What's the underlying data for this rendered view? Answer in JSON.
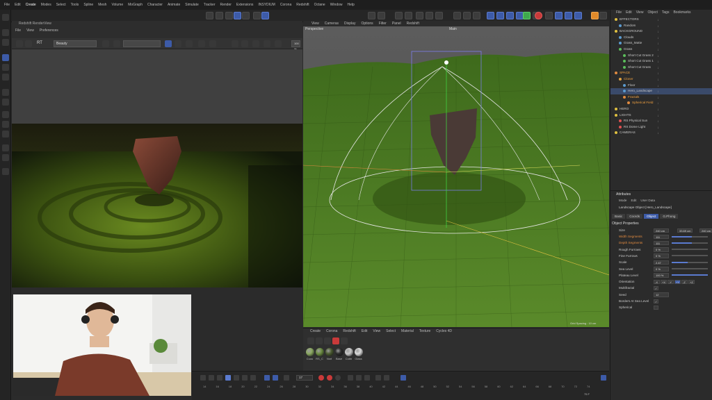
{
  "menubar": [
    "File",
    "Edit",
    "Create",
    "Modes",
    "Select",
    "Tools",
    "Spline",
    "Mesh",
    "Volume",
    "MoGraph",
    "Character",
    "Animate",
    "Simulate",
    "Tracker",
    "Render",
    "Extensions",
    "INSYDIUM",
    "Corona",
    "Redshift",
    "Octane",
    "Window",
    "Help"
  ],
  "menubar_active": "Create",
  "renderview": {
    "title": "Redshift RenderView",
    "menu": [
      "File",
      "View",
      "Preferences"
    ],
    "mode": "Beauty",
    "zoom": "100 %"
  },
  "viewport": {
    "menu": [
      "View",
      "Cameras",
      "Display",
      "Options",
      "Filter",
      "Panel",
      "Redshift"
    ],
    "label_left": "Perspective",
    "label_center": "Main",
    "grid_spacing": "Grid Spacing : 10 cm"
  },
  "material_panel": {
    "menu": [
      "Create",
      "Corona",
      "Redshift",
      "Edit",
      "View",
      "Select",
      "Material",
      "Texture",
      "Cycles 4D"
    ],
    "materials": [
      {
        "label": "Cuou",
        "color": "#8aa860"
      },
      {
        "label": "RS_C",
        "color": "#6a8a40"
      },
      {
        "label": "Nsrt",
        "color": "#4a5a30"
      },
      {
        "label": "Base",
        "color": "#2a2a2a"
      },
      {
        "label": "Cobb",
        "color": "#c8c8c8"
      },
      {
        "label": "Glass",
        "color": "#dcdcdc"
      }
    ]
  },
  "timeline": {
    "current_frame": "17",
    "ticks": [
      "14",
      "16",
      "18",
      "20",
      "22",
      "24",
      "26",
      "28",
      "30",
      "32",
      "34",
      "36",
      "38",
      "40",
      "42",
      "44",
      "46",
      "48",
      "50",
      "52",
      "54",
      "56",
      "58",
      "60",
      "62",
      "64",
      "66",
      "68",
      "70",
      "72",
      "74"
    ],
    "end_frame": "75 F"
  },
  "objects": {
    "menu": [
      "File",
      "Edit",
      "View",
      "Object",
      "Tags",
      "Bookmarks"
    ],
    "items": [
      {
        "name": "EFFECTORS",
        "indent": 0,
        "color": "#e0c040",
        "state": ""
      },
      {
        "name": "Random",
        "indent": 1,
        "color": "#5b9bd0",
        "state": ""
      },
      {
        "name": "BACKGROUND",
        "indent": 0,
        "color": "#e0c040",
        "state": ""
      },
      {
        "name": "Clouds",
        "indent": 1,
        "color": "#5b9bd0",
        "state": ""
      },
      {
        "name": "Grass_Matte",
        "indent": 1,
        "color": "#5b9bd0",
        "state": ""
      },
      {
        "name": "Grass",
        "indent": 1,
        "color": "#5bbd5b",
        "state": ""
      },
      {
        "name": "Short Cut Grass 2",
        "indent": 2,
        "color": "#5bbd5b",
        "state": ""
      },
      {
        "name": "Short Cut Grass 1",
        "indent": 2,
        "color": "#5bbd5b",
        "state": ""
      },
      {
        "name": "Short Cut Grass",
        "indent": 2,
        "color": "#5bbd5b",
        "state": ""
      },
      {
        "name": "SPACE",
        "indent": 0,
        "color": "#e08a40",
        "state": "hl"
      },
      {
        "name": "Cloner",
        "indent": 1,
        "color": "#e0a040",
        "state": "hl"
      },
      {
        "name": "Floor",
        "indent": 2,
        "color": "#5b9bd0",
        "state": ""
      },
      {
        "name": "Hero_Landscape",
        "indent": 2,
        "color": "#5b9bd0",
        "state": "sel"
      },
      {
        "name": "Fractals",
        "indent": 2,
        "color": "#e08a40",
        "state": "hl"
      },
      {
        "name": "Spherical Field",
        "indent": 3,
        "color": "#e08a40",
        "state": "hl"
      },
      {
        "name": "HERO",
        "indent": 0,
        "color": "#e0c040",
        "state": ""
      },
      {
        "name": "LIGHTS",
        "indent": 0,
        "color": "#e0c040",
        "state": ""
      },
      {
        "name": "RS Physical Sun",
        "indent": 1,
        "color": "#e05050",
        "state": ""
      },
      {
        "name": "RS Dome Light",
        "indent": 1,
        "color": "#e05050",
        "state": ""
      },
      {
        "name": "CAMERAS",
        "indent": 0,
        "color": "#e0c040",
        "state": ""
      }
    ]
  },
  "attributes": {
    "title": "Attributes",
    "menu": [
      "Mode",
      "Edit",
      "User Data"
    ],
    "object_label": "Landscape Object [Hero_Landscape]",
    "tabs": [
      "Basic",
      "Coords",
      "Object",
      "G.Phong"
    ],
    "active_tab": "Object",
    "section": "Object Properties",
    "size": [
      "240 cm",
      "33.69 cm",
      "240 cm"
    ],
    "rows": [
      {
        "label": "Width Segments",
        "value": "111",
        "fill": 0.55,
        "accent": true
      },
      {
        "label": "Depth Segments",
        "value": "111",
        "fill": 0.55,
        "accent": true
      },
      {
        "label": "Rough Furrows",
        "value": "0 %",
        "fill": 0.0,
        "accent": false
      },
      {
        "label": "Fine Furrows",
        "value": "0 %",
        "fill": 0.0,
        "accent": false
      },
      {
        "label": "Scale",
        "value": "2.47",
        "fill": 0.45,
        "accent": false
      },
      {
        "label": "Sea Level",
        "value": "0 %",
        "fill": 0.0,
        "accent": false
      },
      {
        "label": "Plateau Level",
        "value": "100 %",
        "fill": 1.0,
        "accent": false
      },
      {
        "label": "Orientation",
        "value": "+Y",
        "fill": null,
        "accent": false
      },
      {
        "label": "Multifractal",
        "value": "✓",
        "fill": null,
        "accent": false
      },
      {
        "label": "Seed",
        "value": "12",
        "fill": null,
        "accent": false
      },
      {
        "label": "Borders At Sea Level",
        "value": "✓",
        "fill": null,
        "accent": false
      },
      {
        "label": "Spherical",
        "value": "",
        "fill": null,
        "accent": false
      }
    ],
    "size_label": "Size",
    "orientation_options": [
      "-X",
      "+X",
      "-Y",
      "+Y",
      "-Z",
      "+Z"
    ]
  }
}
